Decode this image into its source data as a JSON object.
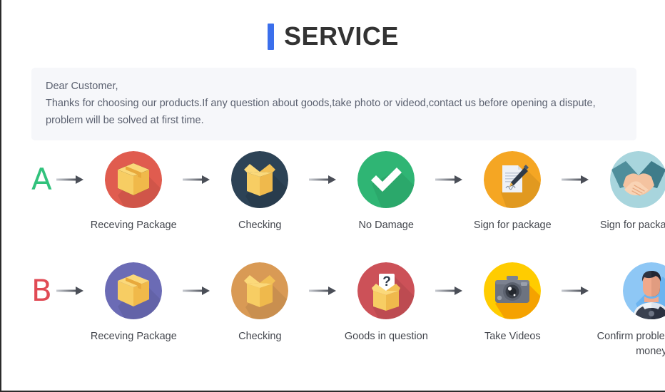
{
  "header": {
    "title": "SERVICE",
    "accent_color": "#3b6fec"
  },
  "notice": {
    "line1": "Dear Customer,",
    "line2": "Thanks for choosing our products.If any question about goods,take photo or videod,contact us before opening a dispute,",
    "line3": "problem will be solved at first time.",
    "background_color": "#f6f7fa",
    "text_color": "#5b6170"
  },
  "flows": [
    {
      "letter": "A",
      "letter_color": "#31c27c",
      "steps": [
        {
          "label": "Receving Package",
          "icon": "closed-box-icon",
          "circle_color": "#e05c4f"
        },
        {
          "label": "Checking",
          "icon": "open-box-icon",
          "circle_color": "#2d4356"
        },
        {
          "label": "No Damage",
          "icon": "checkmark-icon",
          "circle_color": "#2fb574"
        },
        {
          "label": "Sign for package",
          "icon": "document-pen-icon",
          "circle_color": "#f5a623"
        },
        {
          "label": "Sign for package",
          "icon": "handshake-icon",
          "circle_color": "#a8d5dd"
        }
      ]
    },
    {
      "letter": "B",
      "letter_color": "#e04a54",
      "steps": [
        {
          "label": "Receving Package",
          "icon": "closed-box-icon",
          "circle_color": "#6b6bb5"
        },
        {
          "label": "Checking",
          "icon": "open-box-icon",
          "circle_color": "#d99a55"
        },
        {
          "label": "Goods in question",
          "icon": "question-box-icon",
          "circle_color": "#cc5158"
        },
        {
          "label": "Take Videos",
          "icon": "camera-icon",
          "circle_color": "#ffcc00"
        },
        {
          "label": "Confirm problem,refund money",
          "icon": "support-agent-icon",
          "circle_color": "#8ec7f5"
        }
      ]
    }
  ],
  "arrow": {
    "color_start": "#c9ccd2",
    "color_end": "#4a4e57"
  }
}
